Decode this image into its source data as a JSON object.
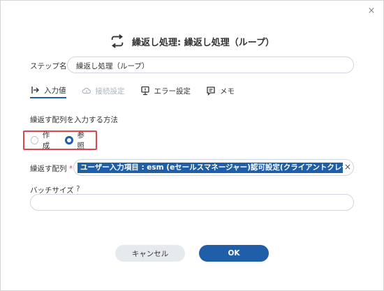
{
  "dialog": {
    "title": "繰返し処理: 繰返し処理（ループ）",
    "close_label": "×"
  },
  "step_name": {
    "label": "ステップ名",
    "value": "繰返し処理（ループ）"
  },
  "tabs": [
    {
      "label": "入力値",
      "icon": "input-icon",
      "state": "active"
    },
    {
      "label": "接続設定",
      "icon": "cloud-icon",
      "state": "disabled"
    },
    {
      "label": "エラー設定",
      "icon": "error-icon",
      "state": "normal"
    },
    {
      "label": "メモ",
      "icon": "memo-icon",
      "state": "normal"
    }
  ],
  "array_input_method": {
    "label": "繰返す配列を入力する方法",
    "options": [
      {
        "label": "作成",
        "checked": false
      },
      {
        "label": "参照",
        "checked": true
      }
    ]
  },
  "array_field": {
    "label": "繰返す配列",
    "required_mark": "*",
    "value": "ユーザー入力項目 : esm (eセールスマネージャー)認可設定(クライアントクレデンシャルフロー",
    "clear_label": "×"
  },
  "batch_size": {
    "label": "バッチサイズ",
    "help": "?",
    "value": ""
  },
  "buttons": {
    "cancel": "キャンセル",
    "ok": "OK"
  },
  "colors": {
    "accent": "#1f5ea8",
    "highlight_border": "#e0454c"
  }
}
